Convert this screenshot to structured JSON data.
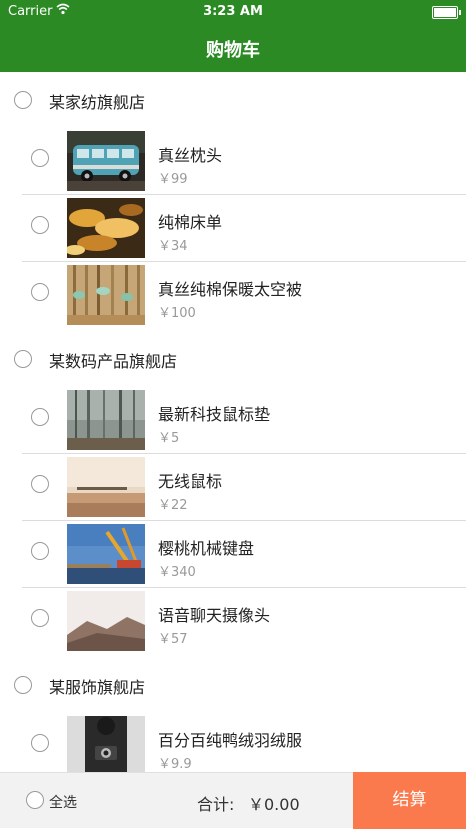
{
  "status_bar": {
    "carrier": "Carrier",
    "time": "3:23 AM"
  },
  "header": {
    "title": "购物车"
  },
  "stores": [
    {
      "name": "某家纺旗舰店",
      "items": [
        {
          "name": "真丝枕头",
          "price": "￥99",
          "image": "van"
        },
        {
          "name": "纯棉床单",
          "price": "￥34",
          "image": "leaves"
        },
        {
          "name": "真丝纯棉保暖太空被",
          "price": "￥100",
          "image": "plants"
        }
      ]
    },
    {
      "name": "某数码产品旗舰店",
      "items": [
        {
          "name": "最新科技鼠标垫",
          "price": "￥5",
          "image": "forest"
        },
        {
          "name": "无线鼠标",
          "price": "￥22",
          "image": "beach"
        },
        {
          "name": "樱桃机械键盘",
          "price": "￥340",
          "image": "crane"
        },
        {
          "name": "语音聊天摄像头",
          "price": "￥57",
          "image": "hills"
        }
      ]
    },
    {
      "name": "某服饰旗舰店",
      "items": [
        {
          "name": "百分百纯鸭绒羽绒服",
          "price": "￥9.9",
          "image": "camera-person"
        }
      ]
    }
  ],
  "footer": {
    "select_all_label": "全选",
    "total_label": "合计:",
    "total_value": "￥0.00",
    "checkout_label": "结算"
  },
  "colors": {
    "header": "#2b8a24",
    "checkout": "#fa7a4e"
  }
}
